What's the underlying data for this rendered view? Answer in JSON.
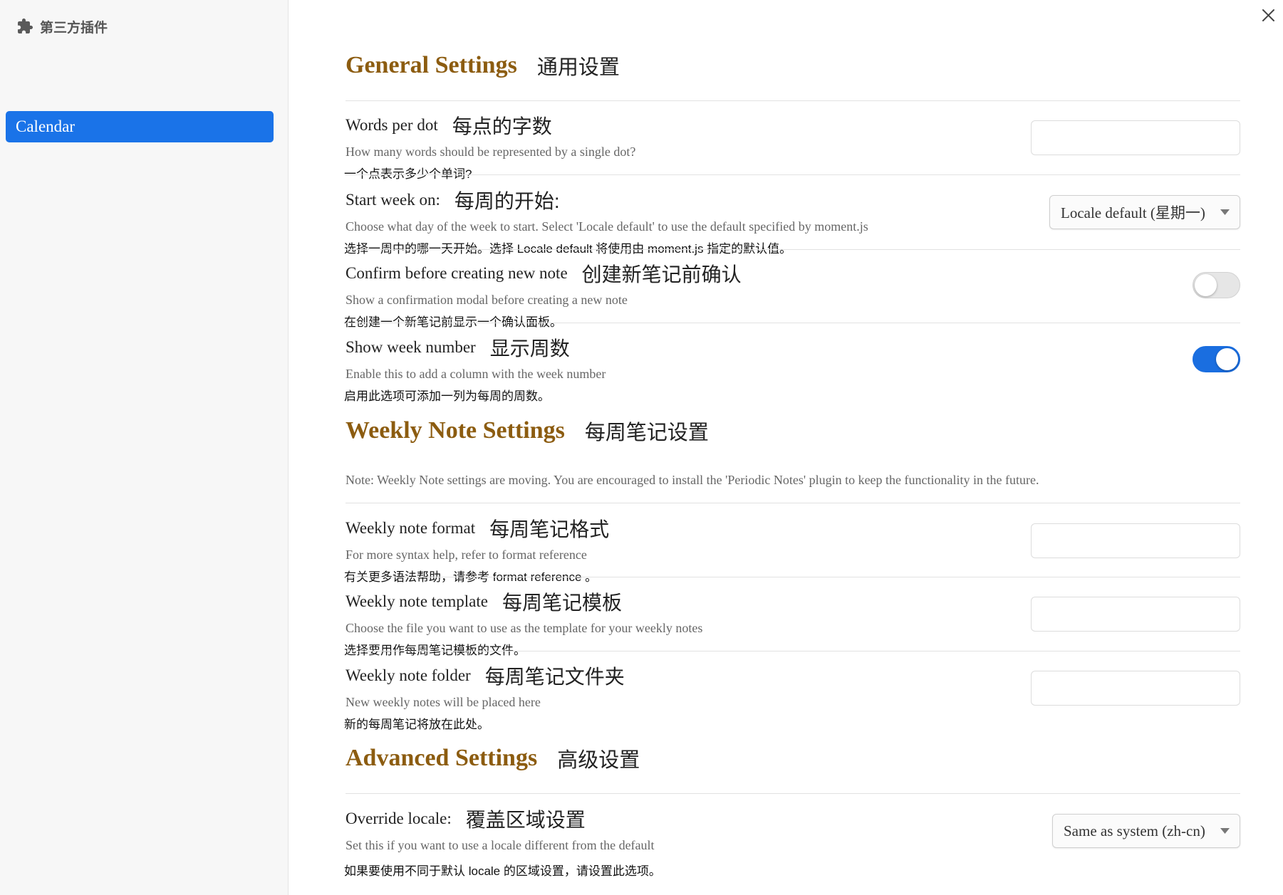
{
  "colors": {
    "accent": "#1a73e8",
    "heading": "#8c5c10",
    "toggle_on": "#1a6ee0"
  },
  "window": {
    "close_icon": "close-icon"
  },
  "sidebar": {
    "icon": "puzzle-icon",
    "title": "第三方插件",
    "items": [
      {
        "label": "Calendar",
        "active": true
      }
    ]
  },
  "general": {
    "heading": "General Settings",
    "heading_zh": "通用设置",
    "words_per_dot": {
      "name": "Words per dot",
      "name_zh": "每点的字数",
      "desc": "How many words should be represented by a single dot?",
      "desc_zh": "一个点表示多少个单词?"
    },
    "start_week": {
      "name": "Start week on:",
      "name_zh": "每周的开始:",
      "desc": "Choose what day of the week to start. Select 'Locale default' to use the default specified by moment.js",
      "desc_zh": "选择一周中的哪一天开始。选择 Locale default 将使用由 moment.js 指定的默认值。",
      "selected": "Locale default (星期一)"
    },
    "confirm_new_note": {
      "name": "Confirm before creating new note",
      "name_zh": "创建新笔记前确认",
      "desc": "Show a confirmation modal before creating a new note",
      "desc_zh": "在创建一个新笔记前显示一个确认面板。",
      "enabled": false
    },
    "show_week_number": {
      "name": "Show week number",
      "name_zh": "显示周数",
      "desc": "Enable this to add a column with the week number",
      "desc_zh": "启用此选项可添加一列为每周的周数。",
      "enabled": true
    }
  },
  "weekly": {
    "heading": "Weekly Note Settings",
    "heading_zh": "每周笔记设置",
    "note": "Note: Weekly Note settings are moving. You are encouraged to install the 'Periodic Notes' plugin to keep the functionality in the future.",
    "format": {
      "name": "Weekly note format",
      "name_zh": "每周笔记格式",
      "desc": "For more syntax help, refer to format reference",
      "desc_zh": "有关更多语法帮助，请参考 format reference 。"
    },
    "template": {
      "name": "Weekly note template",
      "name_zh": "每周笔记模板",
      "desc": "Choose the file you want to use as the template for your weekly notes",
      "desc_zh": "选择要用作每周笔记模板的文件。"
    },
    "folder": {
      "name": "Weekly note folder",
      "name_zh": "每周笔记文件夹",
      "desc": "New weekly notes will be placed here",
      "desc_zh": "新的每周笔记将放在此处。"
    }
  },
  "advanced": {
    "heading": "Advanced Settings",
    "heading_zh": "高级设置",
    "override_locale": {
      "name": "Override locale:",
      "name_zh": "覆盖区域设置",
      "desc": "Set this if you want to use a locale different from the default",
      "desc_zh": "如果要使用不同于默认 locale 的区域设置，请设置此选项。",
      "selected": "Same as system (zh-cn)"
    }
  }
}
